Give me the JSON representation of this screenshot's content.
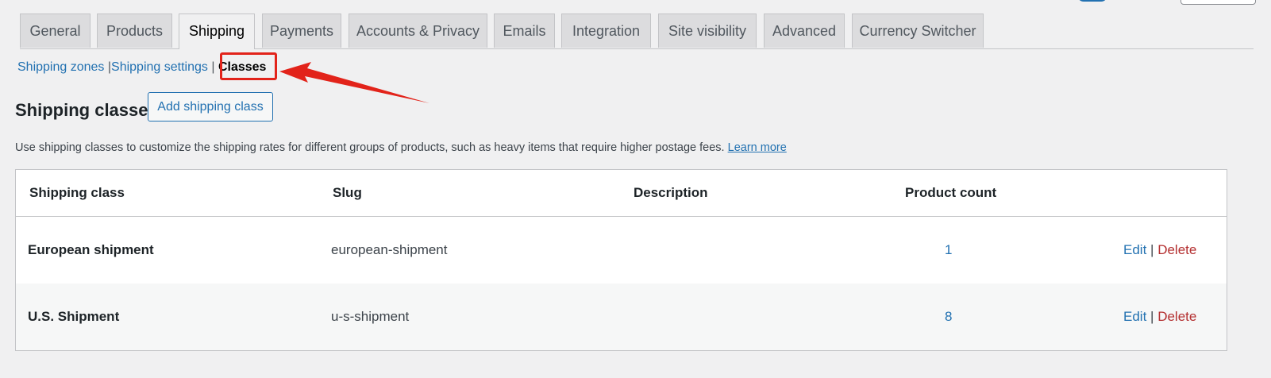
{
  "tabs": [
    {
      "label": "General"
    },
    {
      "label": "Products"
    },
    {
      "label": "Shipping"
    },
    {
      "label": "Payments"
    },
    {
      "label": "Accounts & Privacy"
    },
    {
      "label": "Emails"
    },
    {
      "label": "Integration"
    },
    {
      "label": "Site visibility"
    },
    {
      "label": "Advanced"
    },
    {
      "label": "Currency Switcher"
    }
  ],
  "active_tab": "Shipping",
  "subnav": {
    "zones": "Shipping zones",
    "settings": "Shipping settings",
    "classes": "Classes",
    "separator": "|"
  },
  "page": {
    "title": "Shipping classes",
    "add_button": "Add shipping class",
    "description": "Use shipping classes to customize the shipping rates for different groups of products, such as heavy items that require higher postage fees.",
    "learn_more": "Learn more"
  },
  "table": {
    "headers": {
      "class": "Shipping class",
      "slug": "Slug",
      "description": "Description",
      "count": "Product count"
    },
    "rows": [
      {
        "name": "European shipment",
        "slug": "european-shipment",
        "description": "",
        "count": "1",
        "edit": "Edit",
        "sep": "|",
        "delete": "Delete"
      },
      {
        "name": "U.S. Shipment",
        "slug": "u-s-shipment",
        "description": "",
        "count": "8",
        "edit": "Edit",
        "sep": "|",
        "delete": "Delete"
      }
    ]
  },
  "colors": {
    "link": "#2271b1",
    "delete": "#b32d2e",
    "annotation": "#e2231a",
    "background": "#f0f0f1"
  }
}
